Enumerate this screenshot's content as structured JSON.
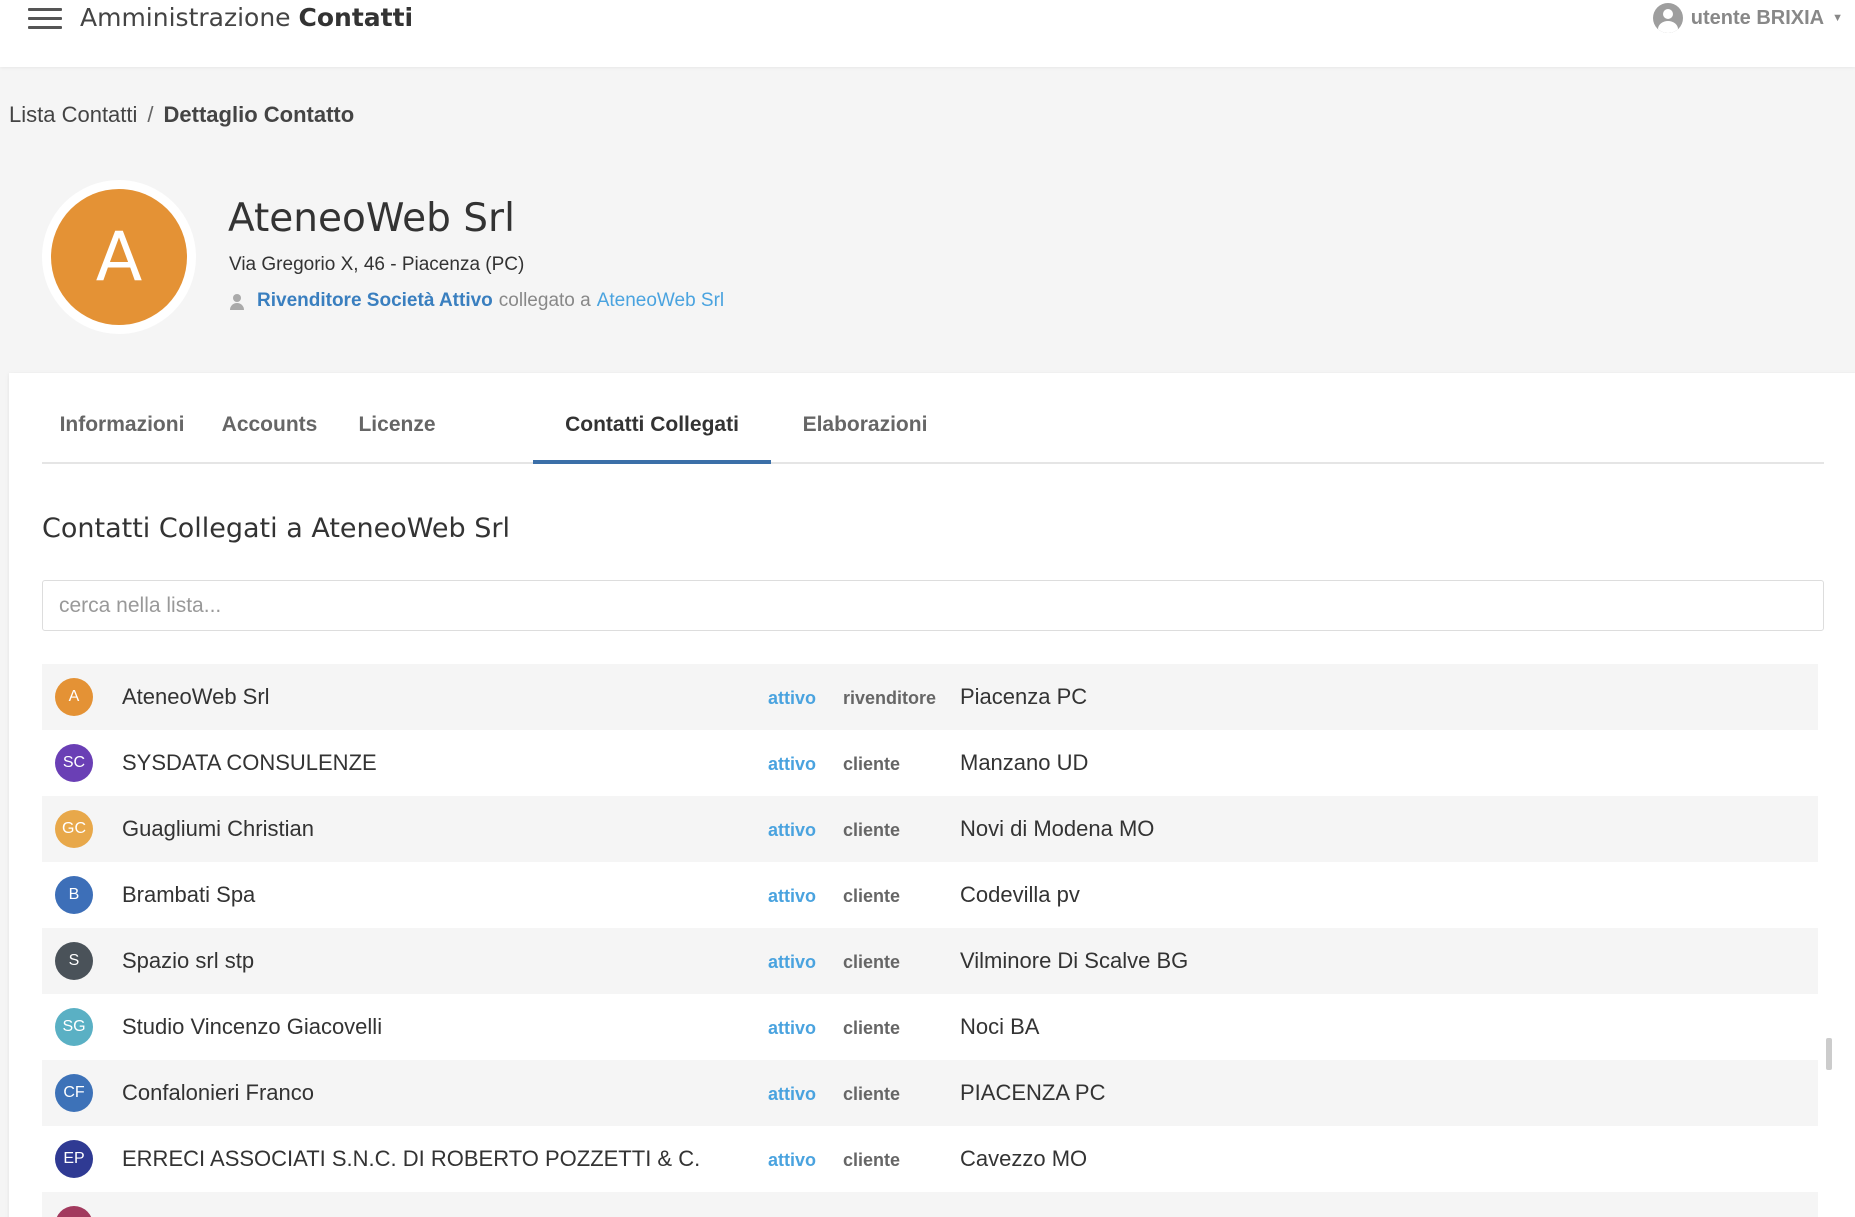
{
  "header": {
    "app_title_prefix": "Amministrazione",
    "app_title_bold": "Contatti",
    "user": "utente BRIXIA"
  },
  "breadcrumb": {
    "items": [
      "Lista Contatti",
      "Dettaglio Contatto"
    ],
    "separator": "/"
  },
  "profile": {
    "initial": "A",
    "avatar_color": "#e49235",
    "name": "AteneoWeb Srl",
    "address": "Via Gregorio X, 46 - Piacenza (PC)",
    "role": "Rivenditore Società Attivo",
    "linked_text": "collegato a",
    "linked_to": "AteneoWeb Srl"
  },
  "tabs": [
    {
      "label": "Informazioni"
    },
    {
      "label": "Accounts"
    },
    {
      "label": "Licenze"
    },
    {
      "label": "Contatti Collegati",
      "active": true
    },
    {
      "label": "Elaborazioni"
    }
  ],
  "section": {
    "title": "Contatti Collegati a AteneoWeb Srl",
    "search_placeholder": "cerca nella lista..."
  },
  "contacts": [
    {
      "initials": "A",
      "color": "#e49235",
      "name": "AteneoWeb Srl",
      "status": "attivo",
      "type": "rivenditore",
      "city": "Piacenza PC"
    },
    {
      "initials": "SC",
      "color": "#6a3fb5",
      "name": "SYSDATA CONSULENZE",
      "status": "attivo",
      "type": "cliente",
      "city": "Manzano UD"
    },
    {
      "initials": "GC",
      "color": "#e8a84a",
      "name": "Guagliumi Christian",
      "status": "attivo",
      "type": "cliente",
      "city": "Novi di Modena MO"
    },
    {
      "initials": "B",
      "color": "#3d6fb8",
      "name": "Brambati Spa",
      "status": "attivo",
      "type": "cliente",
      "city": "Codevilla pv"
    },
    {
      "initials": "S",
      "color": "#4a5259",
      "name": "Spazio srl stp",
      "status": "attivo",
      "type": "cliente",
      "city": "Vilminore Di Scalve BG"
    },
    {
      "initials": "SG",
      "color": "#5ab0c4",
      "name": "Studio Vincenzo Giacovelli",
      "status": "attivo",
      "type": "cliente",
      "city": "Noci BA"
    },
    {
      "initials": "CF",
      "color": "#3d72b8",
      "name": "Confalonieri Franco",
      "status": "attivo",
      "type": "cliente",
      "city": "PIACENZA PC"
    },
    {
      "initials": "EP",
      "color": "#2f3a93",
      "name": "ERRECI ASSOCIATI S.N.C. DI ROBERTO POZZETTI & C.",
      "status": "attivo",
      "type": "cliente",
      "city": "Cavezzo MO"
    },
    {
      "initials": "",
      "color": "#a23a5e",
      "name": "",
      "status": "",
      "type": "",
      "city": ""
    }
  ]
}
